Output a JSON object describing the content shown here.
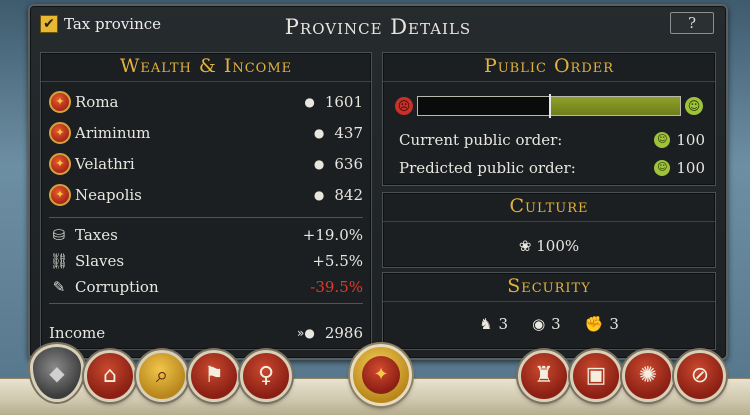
{
  "window": {
    "title": "Province Details",
    "help_label": "?"
  },
  "tax_toggle": {
    "label": "Tax province",
    "checked": true,
    "check_glyph": "✔"
  },
  "wealth": {
    "title": "Wealth & Income",
    "regions": [
      {
        "name": "Roma",
        "value": "1601"
      },
      {
        "name": "Ariminum",
        "value": "437"
      },
      {
        "name": "Velathri",
        "value": "636"
      },
      {
        "name": "Neapolis",
        "value": "842"
      }
    ],
    "modifiers": [
      {
        "label": "Taxes",
        "value": "+19.0%",
        "icon": "money-bag-icon"
      },
      {
        "label": "Slaves",
        "value": "+5.5%",
        "icon": "slave-chains-icon"
      },
      {
        "label": "Corruption",
        "value": "-39.5%",
        "icon": "corruption-scroll-icon"
      }
    ],
    "income_label": "Income",
    "income_value": "2986"
  },
  "public_order": {
    "title": "Public Order",
    "level_percent": 100,
    "marker_fraction": 0.5,
    "current_label": "Current public order:",
    "current_value": "100",
    "predicted_label": "Predicted public order:",
    "predicted_value": "100"
  },
  "culture": {
    "title": "Culture",
    "value": "100%"
  },
  "security": {
    "title": "Security",
    "items": [
      {
        "icon": "eagle-icon",
        "value": "3"
      },
      {
        "icon": "eye-icon",
        "value": "3"
      },
      {
        "icon": "fist-icon",
        "value": "3"
      }
    ]
  },
  "colors": {
    "accent_gold": "#e3b23c",
    "negative_red": "#e03a2a",
    "order_green": "#8ea02a"
  }
}
